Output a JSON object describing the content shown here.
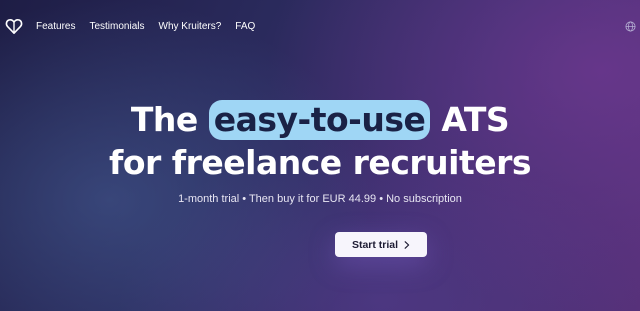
{
  "nav": {
    "logo_icon": "heart-logo-icon",
    "links": [
      {
        "label": "Features"
      },
      {
        "label": "Testimonials"
      },
      {
        "label": "Why Kruiters?"
      },
      {
        "label": "FAQ"
      }
    ],
    "language_icon": "globe-icon"
  },
  "hero": {
    "title_part1": "The",
    "title_highlight": "easy-to-use",
    "title_part2": "ATS",
    "title_line2": "for freelance recruiters",
    "subtitle": "1-month trial • Then buy it for EUR 44.99 • No subscription",
    "cta_label": "Start trial",
    "cta_icon": "chevron-right-icon"
  },
  "colors": {
    "highlight_bg": "#9fd6f5",
    "button_bg": "#f7f5fc",
    "button_text": "#1d1b33"
  }
}
